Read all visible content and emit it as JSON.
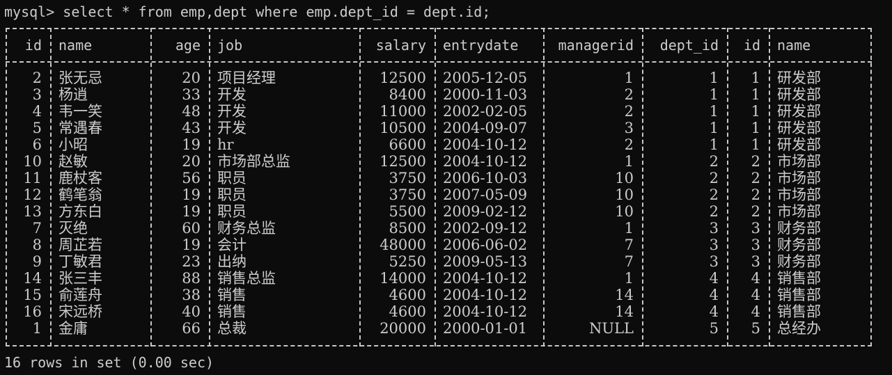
{
  "terminal": {
    "prompt": "mysql> select * from emp,dept where emp.dept_id = dept.id;",
    "status": "16 rows in set (0.00 sec)"
  },
  "table": {
    "columns": [
      "id",
      "name",
      "age",
      "job",
      "salary",
      "entrydate",
      "managerid",
      "dept_id",
      "id",
      "name"
    ],
    "rows": [
      [
        "2",
        "张无忌",
        "20",
        "项目经理",
        "12500",
        "2005-12-05",
        "1",
        "1",
        "1",
        "研发部"
      ],
      [
        "3",
        "杨逍",
        "33",
        "开发",
        "8400",
        "2000-11-03",
        "2",
        "1",
        "1",
        "研发部"
      ],
      [
        "4",
        "韦一笑",
        "48",
        "开发",
        "11000",
        "2002-02-05",
        "2",
        "1",
        "1",
        "研发部"
      ],
      [
        "5",
        "常遇春",
        "43",
        "开发",
        "10500",
        "2004-09-07",
        "3",
        "1",
        "1",
        "研发部"
      ],
      [
        "6",
        "小昭",
        "19",
        "hr",
        "6600",
        "2004-10-12",
        "2",
        "1",
        "1",
        "研发部"
      ],
      [
        "10",
        "赵敏",
        "20",
        "市场部总监",
        "12500",
        "2004-10-12",
        "1",
        "2",
        "2",
        "市场部"
      ],
      [
        "11",
        "鹿杖客",
        "56",
        "职员",
        "3750",
        "2006-10-03",
        "10",
        "2",
        "2",
        "市场部"
      ],
      [
        "12",
        "鹤笔翁",
        "19",
        "职员",
        "3750",
        "2007-05-09",
        "10",
        "2",
        "2",
        "市场部"
      ],
      [
        "13",
        "方东白",
        "19",
        "职员",
        "5500",
        "2009-02-12",
        "10",
        "2",
        "2",
        "市场部"
      ],
      [
        "7",
        "灭绝",
        "60",
        "财务总监",
        "8500",
        "2002-09-12",
        "1",
        "3",
        "3",
        "财务部"
      ],
      [
        "8",
        "周芷若",
        "19",
        "会计",
        "48000",
        "2006-06-02",
        "7",
        "3",
        "3",
        "财务部"
      ],
      [
        "9",
        "丁敏君",
        "23",
        "出纳",
        "5250",
        "2009-05-13",
        "7",
        "3",
        "3",
        "财务部"
      ],
      [
        "14",
        "张三丰",
        "88",
        "销售总监",
        "14000",
        "2004-10-12",
        "1",
        "4",
        "4",
        "销售部"
      ],
      [
        "15",
        "俞莲舟",
        "38",
        "销售",
        "4600",
        "2004-10-12",
        "14",
        "4",
        "4",
        "销售部"
      ],
      [
        "16",
        "宋远桥",
        "40",
        "销售",
        "4600",
        "2004-10-12",
        "14",
        "4",
        "4",
        "销售部"
      ],
      [
        "1",
        "金庸",
        "66",
        "总裁",
        "20000",
        "2000-01-01",
        "NULL",
        "5",
        "5",
        "总经办"
      ]
    ]
  }
}
